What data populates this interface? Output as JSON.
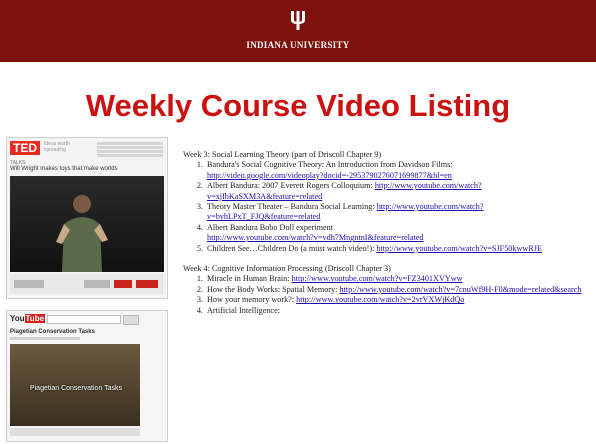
{
  "banner": {
    "university": "INDIANA UNIVERSITY",
    "background_color": "#7d110c",
    "logo_icon": "trident-icon"
  },
  "title": "Weekly Course Video Listing",
  "title_color": "#cc1111",
  "screenshot_ted": {
    "logo_text": "TED",
    "tagline": "Ideas worth spreading",
    "talk_label": "TALKS",
    "talk_title": "Will Wright makes toys that make worlds"
  },
  "screenshot_youtube": {
    "logo_text": "You",
    "logo_tube": "Tube",
    "video_title": "Piagetian Conservation Tasks",
    "caption": "Piagetian Conservation Tasks"
  },
  "weeks": [
    {
      "heading": "Week 3: Social Learning Theory (part of Driscoll Chapter 9)",
      "items": [
        {
          "text": "Bandura's Social Cognitive Theory: An Introduction from Davidson Films:",
          "link": "http://video.google.com/videoplay?docid=-2953790276071699877&hl=en",
          "link_inline": false
        },
        {
          "text": "Albert Bandura: 2007 Everett Rogers Colloquium:",
          "link": "http://www.youtube.com/watch?v=xjIbKaSXM3A&feature=related",
          "link_inline": true
        },
        {
          "text": "Theory Master Theater – Bandura Social Learning:",
          "link": "http://www.youtube.com/watch?v=byhLPxT_FJQ&feature=related",
          "link_inline": true
        },
        {
          "text": "Albert Bandura Bobo Doll experiment",
          "link": "http://www.youtube.com/watch?v=vdh7MngntnI&feature=related",
          "link_inline": false
        },
        {
          "text": "Children See…Children Do (a must watch video!):",
          "link": "http://www.youtube.com/watch?v=SJF50kwwRJE",
          "link_inline": true
        }
      ]
    },
    {
      "heading": "Week 4: Cognitive Information Processing (Driscoll Chapter 3)",
      "items": [
        {
          "text": "Miracle in Human Brain:",
          "link": "http://www.youtube.com/watch?v=FZ3401XVYww",
          "link_inline": true
        },
        {
          "text": "How the Body Works: Spatial Memory:",
          "link": "http://www.youtube.com/watch?v=7cnuWf9H-F0&mode=related&search",
          "link_inline": true
        },
        {
          "text": "How your memory work?:",
          "link": "http://www.youtube.com/watch?v=2vrVXWjKdQo",
          "link_inline": true
        },
        {
          "text": "Artificial Intelligence:",
          "link": "",
          "link_inline": true
        }
      ]
    }
  ]
}
